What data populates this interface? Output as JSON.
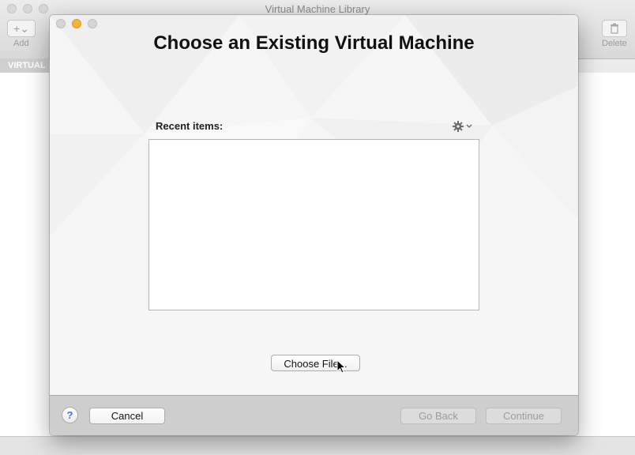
{
  "background_window": {
    "title": "Virtual Machine Library",
    "add_label": "Add",
    "add_icon": "plus-dropdown-icon",
    "delete_label": "Delete",
    "delete_icon": "trash-icon",
    "sidebar_header": "VIRTUAL"
  },
  "dialog": {
    "title": "Choose an Existing Virtual Machine",
    "recent_label": "Recent items:",
    "gear_icon": "gear-dropdown-icon",
    "recent_items": [],
    "choose_file_label": "Choose File...",
    "footer": {
      "help_label": "?",
      "cancel_label": "Cancel",
      "go_back_label": "Go Back",
      "continue_label": "Continue"
    }
  },
  "colors": {
    "minimize_light": "#f5b33b",
    "help_accent": "#3a78d8",
    "disabled_text": "#9c9c9c"
  }
}
